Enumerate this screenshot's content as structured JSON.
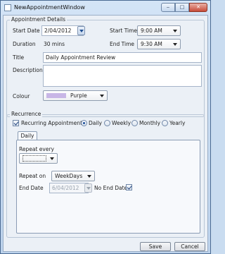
{
  "window": {
    "title": "NewAppointmentWindow"
  },
  "details": {
    "group_label": "Appointment Details",
    "start_date_label": "Start Date",
    "start_date_value": "2/04/2012",
    "start_time_label": "Start Time",
    "start_time_value": "9:00 AM",
    "duration_label": "Duration",
    "duration_value": "30 mins",
    "end_time_label": "End Time",
    "end_time_value": "9:30 AM",
    "title_label": "Title",
    "title_value": "Daily Appointment Review",
    "description_label": "Description",
    "description_value": "",
    "colour_label": "Colour",
    "colour_value": "Purple",
    "colour_swatch": "#c8b6e6"
  },
  "recurrence": {
    "group_label": "Recurrence",
    "recurring_label": "Recurring Appointment",
    "recurring_checked": true,
    "options": [
      "Daily",
      "Weekly",
      "Monthly",
      "Yearly"
    ],
    "selected_option": "Daily",
    "tab_label": "Daily",
    "repeat_every_label": "Repeat every",
    "repeat_every_value": "",
    "repeat_on_label": "Repeat on",
    "repeat_on_value": "WeekDays",
    "end_date_label": "End Date",
    "end_date_value": "6/04/2012",
    "no_end_date_label": "No End Date",
    "no_end_date_checked": true
  },
  "buttons": {
    "save": "Save",
    "cancel": "Cancel"
  }
}
